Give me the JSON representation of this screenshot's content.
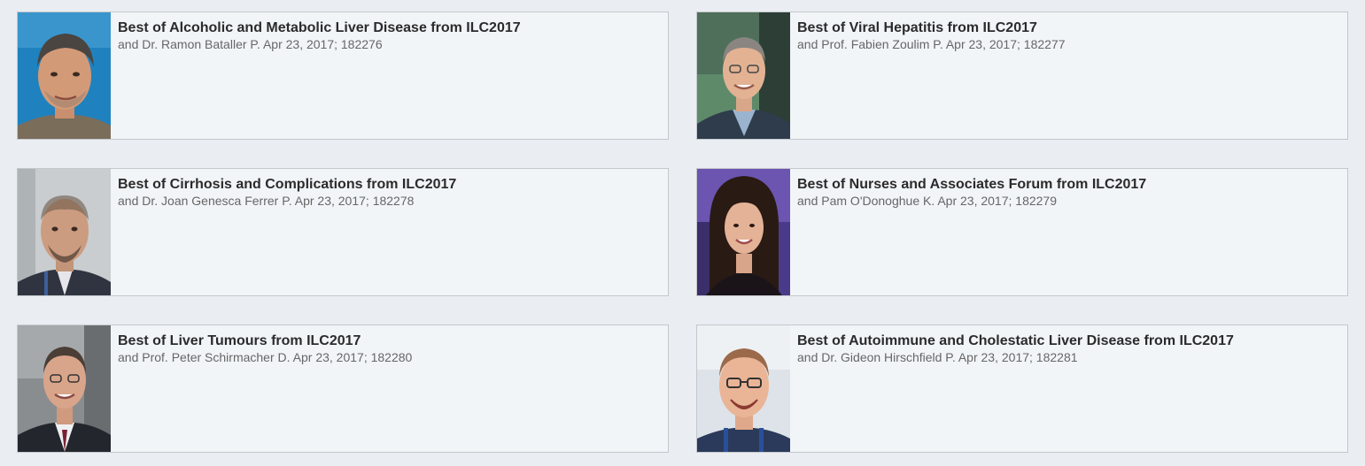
{
  "colors": {
    "page_bg": "#eaeef2",
    "card_bg": "#f2f5f8",
    "card_border": "#c4c8cc",
    "title": "#2b2b2b",
    "meta": "#666666"
  },
  "cards": [
    {
      "title": "Best of Alcoholic and Metabolic Liver Disease from ILC2017",
      "byline": "and Dr. Ramon Bataller P. Apr 23, 2017; 182276",
      "photo": "speaker-photo-blue-bg"
    },
    {
      "title": "Best of Viral Hepatitis from ILC2017",
      "byline": "and Prof. Fabien Zoulim P. Apr 23, 2017; 182277",
      "photo": "speaker-photo-green-bg"
    },
    {
      "title": "Best of Cirrhosis and Complications from ILC2017",
      "byline": "and Dr. Joan Genesca Ferrer P. Apr 23, 2017; 182278",
      "photo": "speaker-photo-grey-bg"
    },
    {
      "title": "Best of Nurses and Associates Forum from ILC2017",
      "byline": "and Pam O'Donoghue K. Apr 23, 2017; 182279",
      "photo": "speaker-photo-purple-bg"
    },
    {
      "title": "Best of Liver Tumours from ILC2017",
      "byline": "and Prof. Peter Schirmacher D. Apr 23, 2017; 182280",
      "photo": "speaker-photo-grey-bg"
    },
    {
      "title": "Best of Autoimmune and Cholestatic Liver Disease from ILC2017",
      "byline": "and Dr. Gideon Hirschfield P. Apr 23, 2017; 182281",
      "photo": "speaker-photo-light-bg"
    }
  ]
}
